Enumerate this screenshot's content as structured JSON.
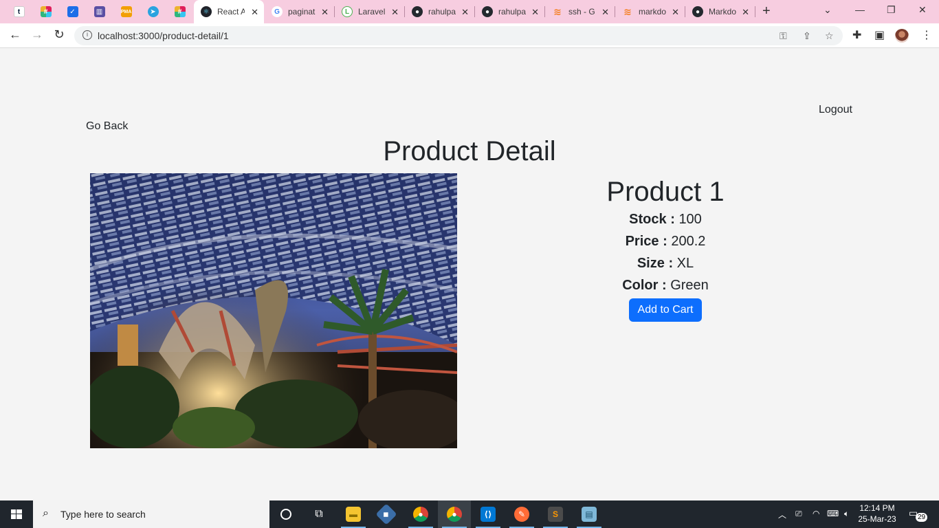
{
  "browser": {
    "tabs": [
      {
        "title": "",
        "icon": "tumblr-icon",
        "pinned": true
      },
      {
        "title": "",
        "icon": "slack-icon",
        "pinned": true
      },
      {
        "title": "",
        "icon": "pocket-icon",
        "pinned": true
      },
      {
        "title": "",
        "icon": "trello-icon",
        "pinned": true
      },
      {
        "title": "",
        "icon": "phpmyadmin-icon",
        "pinned": true
      },
      {
        "title": "",
        "icon": "telegram-icon",
        "pinned": true
      },
      {
        "title": "",
        "icon": "slack-icon",
        "pinned": true
      },
      {
        "title": "React A",
        "icon": "react-icon",
        "active": true
      },
      {
        "title": "paginat",
        "icon": "google-icon"
      },
      {
        "title": "Laravel",
        "icon": "laravel-icon"
      },
      {
        "title": "rahulpa",
        "icon": "github-icon"
      },
      {
        "title": "rahulpa",
        "icon": "github-icon"
      },
      {
        "title": "ssh - G",
        "icon": "stackoverflow-icon"
      },
      {
        "title": "markdo",
        "icon": "stackoverflow-icon"
      },
      {
        "title": "Markdo",
        "icon": "github-icon"
      }
    ],
    "url": "localhost:3000/product-detail/1"
  },
  "page": {
    "logout_label": "Logout",
    "go_back_label": "Go Back",
    "title": "Product Detail",
    "product": {
      "name": "Product 1",
      "stock_label": "Stock",
      "stock": "100",
      "price_label": "Price",
      "price": "200.2",
      "size_label": "Size",
      "size": "XL",
      "color_label": "Color",
      "color": "Green",
      "separator": ":"
    },
    "add_to_cart_label": "Add to Cart"
  },
  "taskbar": {
    "search_placeholder": "Type here to search",
    "time": "12:14 PM",
    "date": "25-Mar-23",
    "notification_count": "29",
    "apps": [
      "cortana-icon",
      "task-view-icon",
      "file-explorer-icon",
      "git-icon",
      "chrome-icon",
      "chrome-icon",
      "vscode-icon",
      "postman-icon",
      "sublime-icon",
      "notepad-icon"
    ]
  },
  "colors": {
    "tab_strip": "#f7cde0",
    "page_background": "#f4f4f4",
    "primary_button": "#0d6efd",
    "taskbar": "#20262d"
  }
}
